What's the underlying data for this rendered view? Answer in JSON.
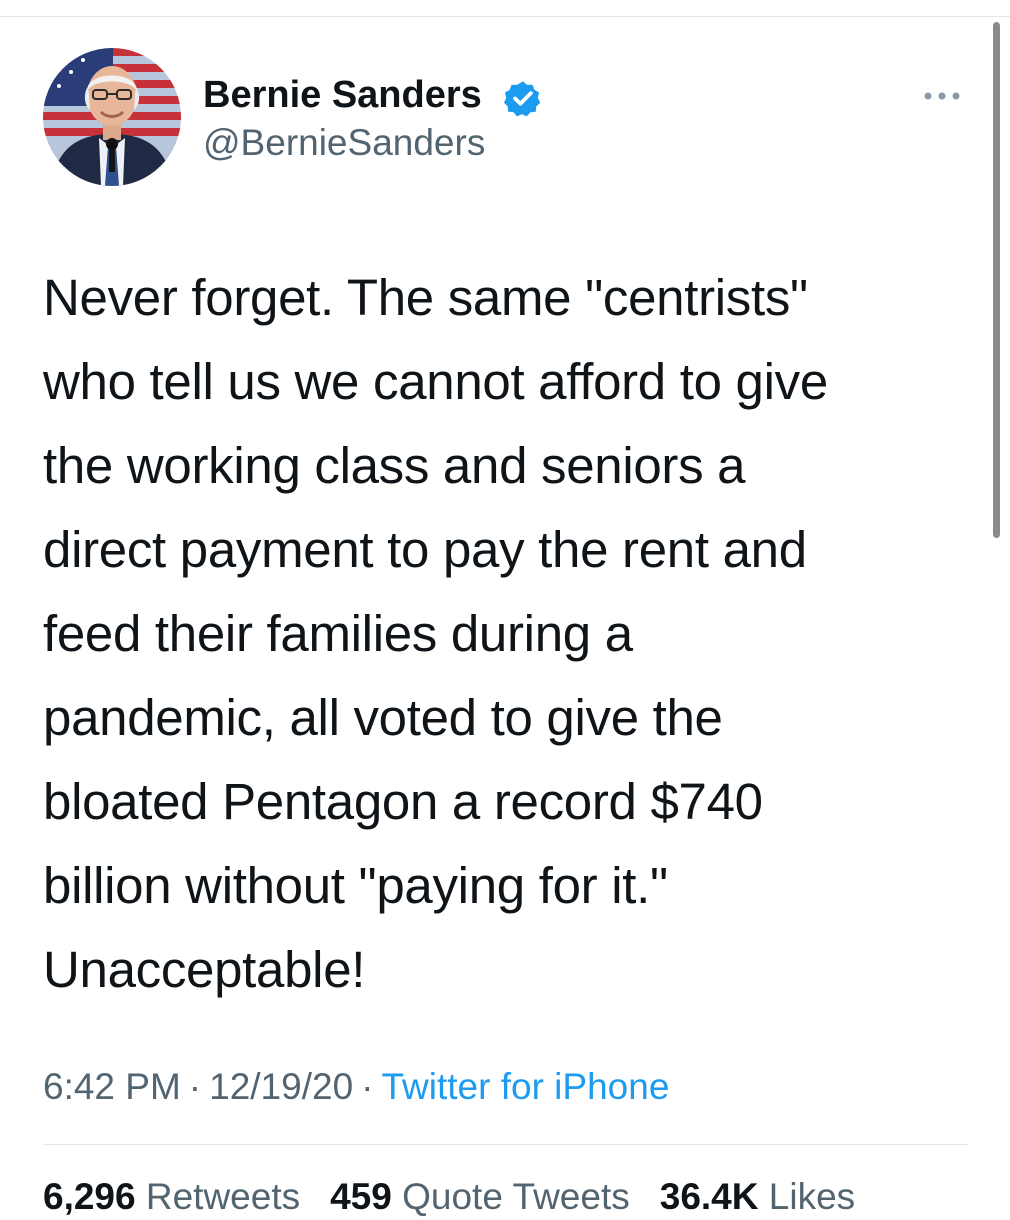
{
  "tweet": {
    "author": {
      "display_name": "Bernie Sanders",
      "handle": "@BernieSanders",
      "verified": true
    },
    "text": "Never forget. The same \"centrists\"\nwho tell us we cannot afford to give\nthe working class and seniors a\ndirect payment to pay the rent and\nfeed their families during a\npandemic, all voted to give the\nbloated Pentagon a record $740\nbillion without \"paying for it.\"\nUnacceptable!",
    "time": "6:42 PM",
    "date": "12/19/20",
    "separator": "·",
    "source": "Twitter for iPhone",
    "stats": {
      "retweets_count": "6,296",
      "retweets_label": "Retweets",
      "quote_count": "459",
      "quote_label": "Quote Tweets",
      "likes_count": "36.4K",
      "likes_label": "Likes"
    }
  },
  "icons": {
    "verified": "verified-badge-icon",
    "more": "more-options-icon"
  },
  "colors": {
    "text_primary": "#0f1419",
    "text_secondary": "#536471",
    "accent": "#1d9bf0",
    "verified": "#1d9bf0"
  }
}
